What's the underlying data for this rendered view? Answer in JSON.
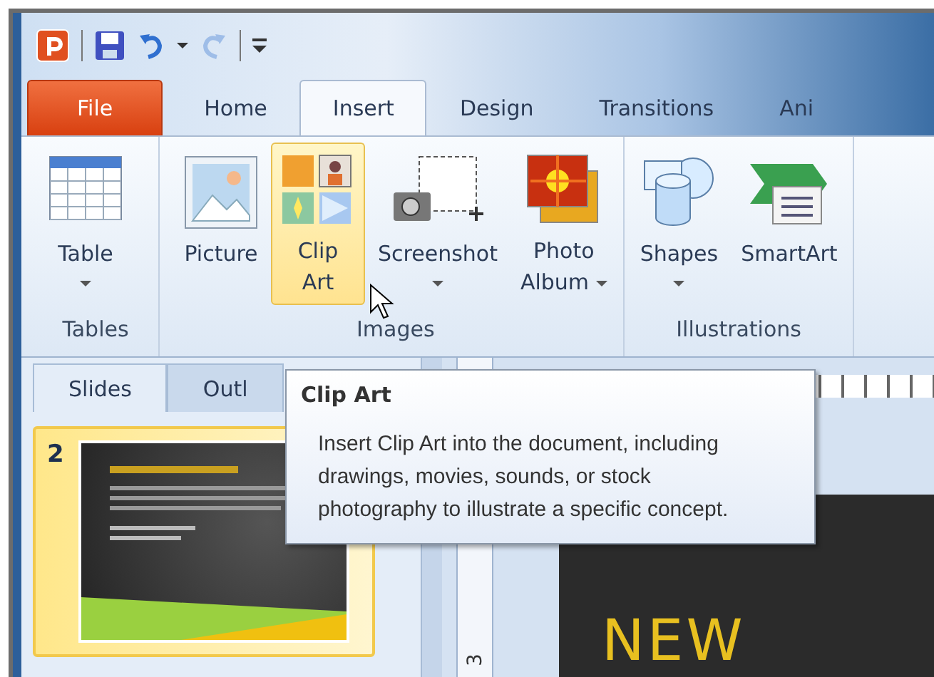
{
  "quick_access": [
    {
      "kind": "app"
    },
    {
      "kind": "save"
    },
    {
      "kind": "undo"
    },
    {
      "kind": "dropdown"
    },
    {
      "kind": "redo",
      "disabled": true
    },
    {
      "kind": "customize"
    }
  ],
  "tabs": [
    {
      "label": "File",
      "kind": "file",
      "selected": false
    },
    {
      "label": "Home",
      "kind": "tab",
      "selected": false
    },
    {
      "label": "Insert",
      "kind": "tab",
      "selected": true
    },
    {
      "label": "Design",
      "kind": "tab",
      "selected": false
    },
    {
      "label": "Transitions",
      "kind": "tab",
      "selected": false
    },
    {
      "label": "Ani",
      "kind": "tab",
      "selected": false
    }
  ],
  "ribbon_groups": [
    {
      "label": "Tables",
      "buttons": [
        {
          "label": "Table",
          "kind": "table",
          "dropdown": true,
          "highlighted": false
        }
      ]
    },
    {
      "label": "Images",
      "buttons": [
        {
          "label": "Picture",
          "kind": "picture",
          "dropdown": false,
          "highlighted": false
        },
        {
          "label": "Clip Art",
          "kind": "clipart",
          "dropdown": false,
          "highlighted": true
        },
        {
          "label": "Screenshot",
          "kind": "screenshot",
          "dropdown": true,
          "highlighted": false
        },
        {
          "label": "Photo Album",
          "kind": "album",
          "dropdown": true,
          "highlighted": false
        }
      ]
    },
    {
      "label": "Illustrations",
      "buttons": [
        {
          "label": "Shapes",
          "kind": "shapes",
          "dropdown": true,
          "highlighted": false
        },
        {
          "label": "SmartArt",
          "kind": "smartart",
          "dropdown": false,
          "highlighted": false
        }
      ]
    }
  ],
  "pane_tabs": [
    {
      "label": "Slides",
      "selected": true
    },
    {
      "label": "Outl",
      "selected": false
    }
  ],
  "slides": [
    {
      "number": "2",
      "selected": true
    }
  ],
  "ruler": {
    "number": "3"
  },
  "slide": {
    "title": "NEW"
  },
  "tooltip": {
    "title": "Clip Art",
    "text": "Insert Clip Art into the document, including drawings, movies, sounds, or stock photography to illustrate a specific concept."
  }
}
